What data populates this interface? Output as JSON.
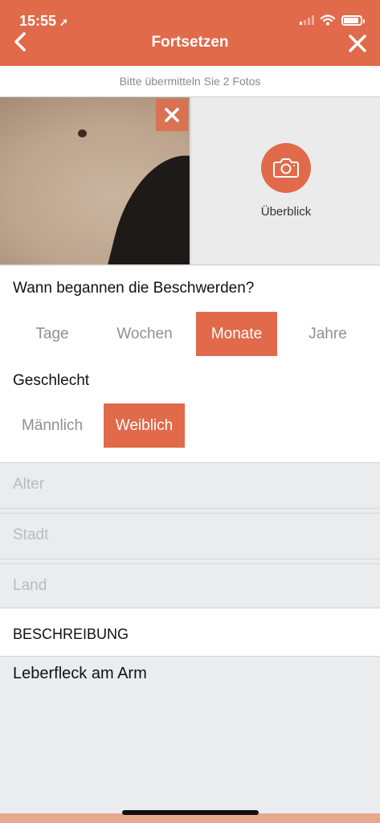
{
  "status_bar": {
    "time": "15:55",
    "location_arrow": "location-arrow-icon",
    "signal_icon": "signal-icon",
    "wifi_icon": "wifi-icon",
    "battery_icon": "battery-icon"
  },
  "nav": {
    "title": "Fortsetzen",
    "back_icon": "chevron-left-icon",
    "close_icon": "close-icon"
  },
  "hint": "Bitte übermitteln Sie 2 Fotos",
  "photos": {
    "second_label": "Überblick",
    "remove_icon": "close-icon",
    "camera_icon": "camera-icon"
  },
  "onset": {
    "question": "Wann begannen die Beschwerden?",
    "options": [
      "Tage",
      "Wochen",
      "Monate",
      "Jahre"
    ],
    "selected": "Monate"
  },
  "gender": {
    "question": "Geschlecht",
    "options": [
      "Männlich",
      "Weiblich"
    ],
    "selected": "Weiblich"
  },
  "fields": {
    "age_placeholder": "Alter",
    "city_placeholder": "Stadt",
    "country_placeholder": "Land"
  },
  "description": {
    "heading": "BESCHREIBUNG",
    "value": "Leberfleck am Arm"
  },
  "colors": {
    "accent": "#e06a4a",
    "background": "#ebecee",
    "placeholder": "#b4bcc6"
  }
}
